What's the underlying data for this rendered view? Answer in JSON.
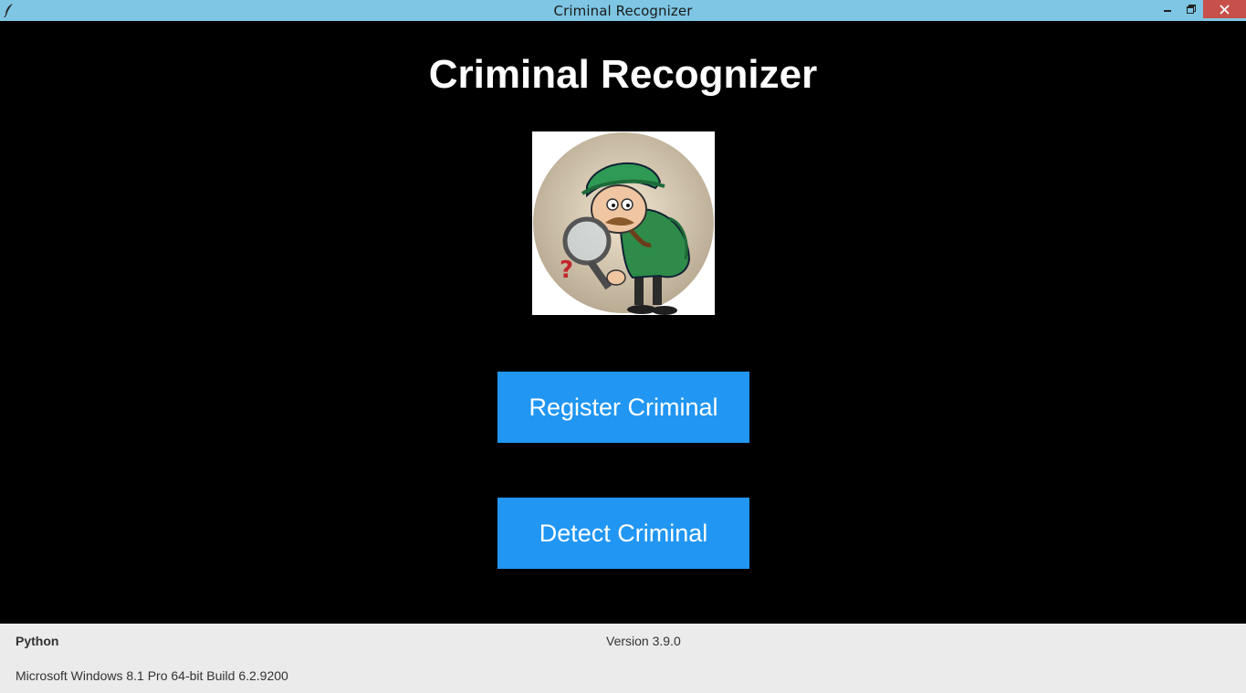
{
  "window": {
    "title": "Criminal Recognizer",
    "icons": {
      "app": "feather-icon",
      "minimize": "minimize-icon",
      "maximize": "restore-icon",
      "close": "close-icon"
    },
    "close_color": "#c7504a",
    "titlebar_color": "#7ec6e3"
  },
  "main": {
    "heading": "Criminal Recognizer",
    "logo": "detective-magnifier-logo",
    "accent_color": "#2196f3",
    "buttons": {
      "register": "Register Criminal",
      "detect": "Detect Criminal"
    }
  },
  "status": {
    "language": "Python",
    "version": "Version 3.9.0",
    "os": "Microsoft Windows 8.1 Pro 64-bit Build 6.2.9200"
  }
}
